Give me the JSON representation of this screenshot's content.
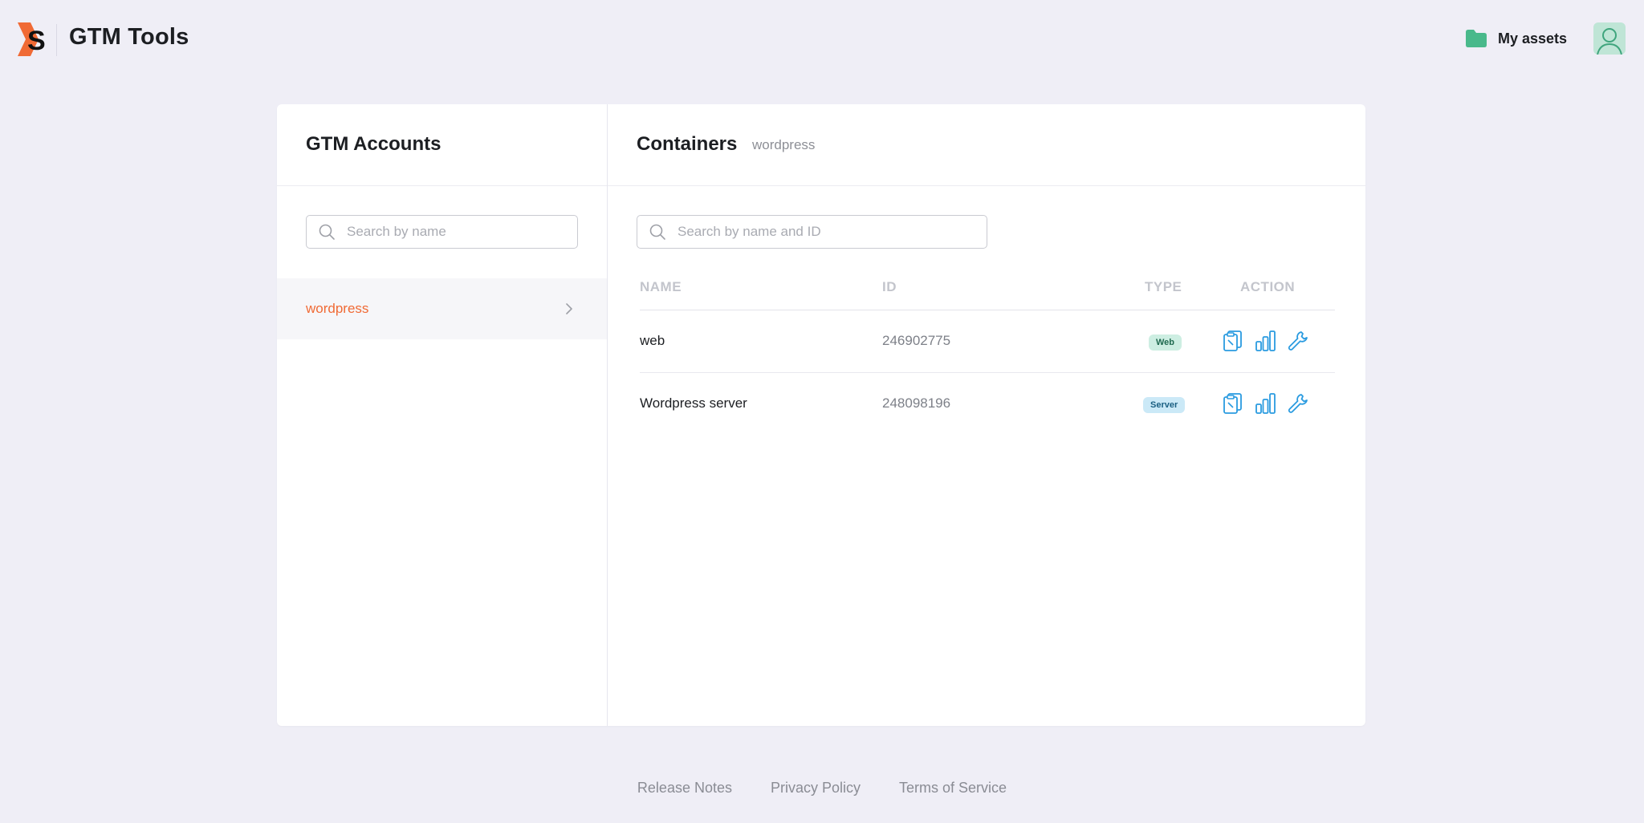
{
  "header": {
    "logo_icon": "stape-logo-icon",
    "title": "GTM Tools",
    "my_assets_label": "My assets",
    "folder_icon": "folder-icon",
    "avatar_icon": "user-avatar-icon",
    "accent_color": "#f06a35",
    "folder_color": "#49b98b"
  },
  "accounts": {
    "title": "GTM Accounts",
    "search_placeholder": "Search by name",
    "items": [
      {
        "name": "wordpress",
        "selected": true
      }
    ]
  },
  "containers": {
    "title": "Containers",
    "subtitle": "wordpress",
    "search_placeholder": "Search by name and ID",
    "columns": [
      "NAME",
      "ID",
      "TYPE",
      "ACTION"
    ],
    "rows": [
      {
        "name": "web",
        "id": "246902775",
        "type": "Web"
      },
      {
        "name": "Wordpress server",
        "id": "248098196",
        "type": "Server"
      }
    ],
    "action_icons": [
      "clipboard-icon",
      "bar-chart-icon",
      "wrench-icon"
    ],
    "action_color": "#2a9be0"
  },
  "footer": {
    "links": [
      "Release Notes",
      "Privacy Policy",
      "Terms of Service"
    ]
  }
}
